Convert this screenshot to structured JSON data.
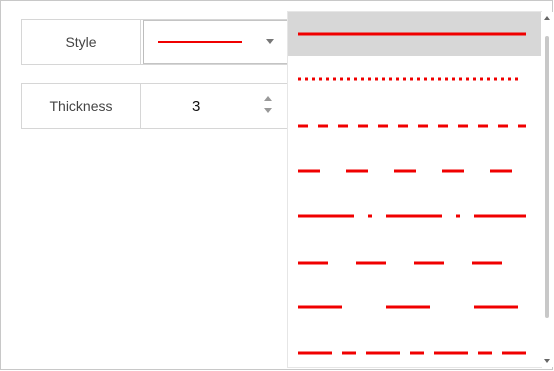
{
  "style_row": {
    "label": "Style",
    "selected_style": "solid"
  },
  "thickness_row": {
    "label": "Thickness",
    "value": "3"
  },
  "line_color": "#f00000",
  "selection_highlight": "#d7d7d7",
  "dropdown": {
    "options": [
      {
        "name": "solid",
        "selected": true
      },
      {
        "name": "dotted",
        "selected": false
      },
      {
        "name": "dashed",
        "selected": false
      },
      {
        "name": "long-dash",
        "selected": false
      },
      {
        "name": "dash-dot",
        "selected": false
      },
      {
        "name": "medium-dash",
        "selected": false
      },
      {
        "name": "long-dash-wide",
        "selected": false
      },
      {
        "name": "long-dash-dash",
        "selected": false
      }
    ]
  }
}
